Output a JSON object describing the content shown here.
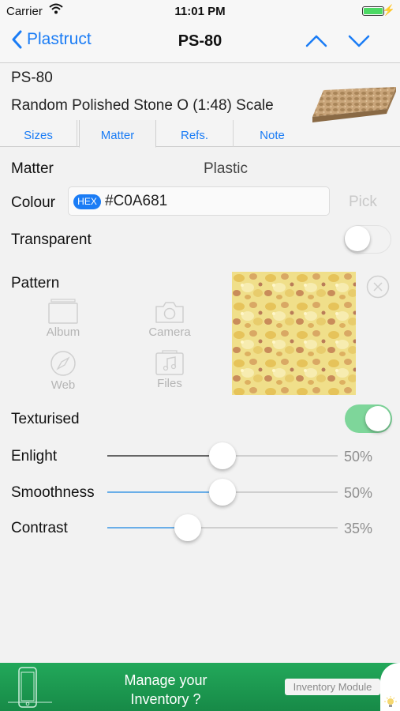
{
  "status_bar": {
    "carrier": "Carrier",
    "time": "11:01 PM"
  },
  "nav": {
    "back_label": "Plastruct",
    "title": "PS-80"
  },
  "item": {
    "code": "PS-80",
    "name": "Random Polished Stone O (1:48) Scale"
  },
  "tabs": [
    {
      "label": "Sizes",
      "active": false
    },
    {
      "label": "Matter",
      "active": true
    },
    {
      "label": "Refs.",
      "active": false
    },
    {
      "label": "Note",
      "active": false
    }
  ],
  "matter": {
    "label": "Matter",
    "value": "Plastic"
  },
  "colour": {
    "label": "Colour",
    "badge": "HEX",
    "value": "#C0A681",
    "pick_label": "Pick"
  },
  "transparent": {
    "label": "Transparent",
    "on": false
  },
  "pattern": {
    "label": "Pattern",
    "sources": [
      {
        "label": "Album",
        "icon": "album-icon"
      },
      {
        "label": "Camera",
        "icon": "camera-icon"
      },
      {
        "label": "Web",
        "icon": "compass-icon"
      },
      {
        "label": "Files",
        "icon": "files-icon"
      }
    ]
  },
  "texturised": {
    "label": "Texturised",
    "on": true
  },
  "sliders": [
    {
      "label": "Enlight",
      "value": 0.5,
      "display": "50%",
      "fill": "#666666"
    },
    {
      "label": "Smoothness",
      "value": 0.5,
      "display": "50%",
      "fill": "#6aaee8"
    },
    {
      "label": "Contrast",
      "value": 0.35,
      "display": "35%",
      "fill": "#6aaee8"
    }
  ],
  "banner": {
    "line1": "Manage your",
    "line2": "Inventory ?",
    "button_label": "Inventory Module"
  },
  "colors": {
    "accent": "#1a7cf5",
    "switch_on": "#7ed69a",
    "banner": "#1f9e52"
  }
}
